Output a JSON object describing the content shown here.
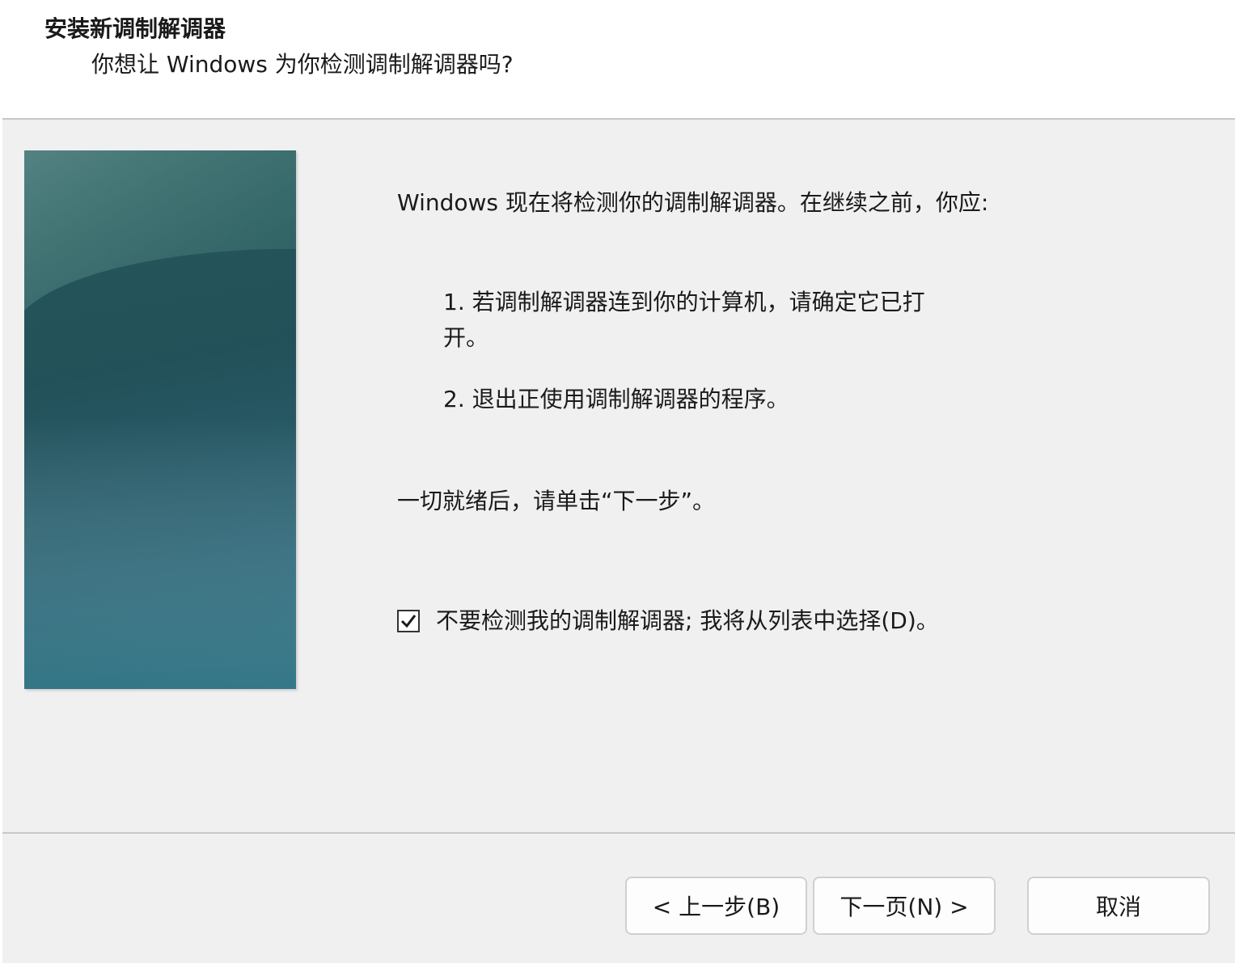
{
  "header": {
    "title": "安装新调制解调器",
    "subtitle": "你想让 Windows 为你检测调制解调器吗?"
  },
  "content": {
    "intro": "Windows 现在将检测你的调制解调器。在继续之前，你应:",
    "steps": [
      "1. 若调制解调器连到你的计算机，请确定它已打开。",
      "2. 退出正使用调制解调器的程序。"
    ],
    "ready": "一切就绪后，请单击“下一步”。",
    "checkbox": {
      "label": "不要检测我的调制解调器; 我将从列表中选择(D)。",
      "checked": true
    }
  },
  "buttons": {
    "back": "< 上一步(B)",
    "next": "下一页(N) >",
    "cancel": "取消"
  }
}
